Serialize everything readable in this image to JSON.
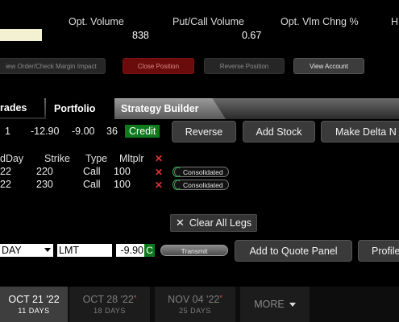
{
  "stats": {
    "opt_volume_label": "Opt. Volume",
    "opt_volume_value": "838",
    "put_call_label": "Put/Call Volume",
    "put_call_value": "0.67",
    "vlm_chng_label": "Opt. Vlm Chng %",
    "cutoff_label": "H"
  },
  "actions": {
    "preview": "iew Order/Check Margin Impact",
    "close": "Close Position",
    "reverse": "Reverse Position",
    "view_account": "View Account"
  },
  "tabs": {
    "trades": "rades",
    "portfolio": "Portfolio",
    "strategy": "Strategy Builder"
  },
  "summary": {
    "qty": "1",
    "price": "-12.90",
    "mid": "-9.00",
    "count": "36",
    "credit": "Credit",
    "reverse_btn": "Reverse",
    "add_stock_btn": "Add Stock",
    "delta_btn": "Make Delta N"
  },
  "legs": {
    "headers": {
      "day": "dDay",
      "strike": "Strike",
      "type": "Type",
      "mult": "Mltplr"
    },
    "rows": [
      {
        "day": "22",
        "strike": "220",
        "type": "Call",
        "mult": "100",
        "routing": "Consolidated"
      },
      {
        "day": "22",
        "strike": "230",
        "type": "Call",
        "mult": "100",
        "routing": "Consolidated"
      }
    ],
    "clear_label": "Clear All Legs"
  },
  "order": {
    "tif": "DAY",
    "type": "LMT",
    "limit": "-9.90",
    "c_badge": "C",
    "transmit": "Transmit",
    "quote_panel": "Add to Quote Panel",
    "profile": "Profile"
  },
  "expiries": [
    {
      "date": "OCT 21 '22",
      "days": "11 DAYS",
      "active": true
    },
    {
      "date": "OCT 28 '22",
      "days": "18 DAYS",
      "active": false
    },
    {
      "date": "NOV 04 '22",
      "days": "25 DAYS",
      "active": false
    }
  ],
  "more_label": "MORE",
  "colors": {
    "credit_green": "#0c7a1d",
    "close_red": "#6b0c0c",
    "marker_red": "#d9534f"
  }
}
